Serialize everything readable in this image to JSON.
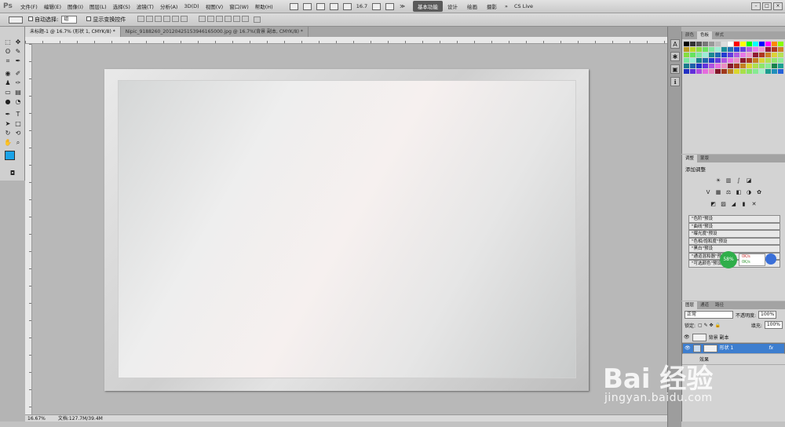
{
  "app": {
    "logo": "Ps"
  },
  "menu": {
    "items": [
      "文件(F)",
      "编辑(E)",
      "图像(I)",
      "图层(L)",
      "选择(S)",
      "滤镜(T)",
      "分析(A)",
      "3D(D)",
      "视图(V)",
      "窗口(W)",
      "帮助(H)"
    ],
    "zoom": "16.7",
    "overflow": "≫",
    "workspaces": [
      "基本功能",
      "设计",
      "绘画",
      "摄影"
    ],
    "cs_live": "CS Live"
  },
  "options": {
    "auto_select_label": "自动选择:",
    "auto_select_value": "组",
    "show_transform_label": "显示变换控件"
  },
  "tabs": [
    {
      "label": "未标题-1 @ 16.7% (形状 1, CMYK/8) *",
      "active": true
    },
    {
      "label": "Nipic_9188260_20120425153946165000.jpg @ 16.7%(背景 副本, CMYK/8) *",
      "active": false
    }
  ],
  "status": {
    "zoom": "16.67%",
    "doc": "文档:127.7M/39.4M"
  },
  "swatch_panel": {
    "tabs": [
      "颜色",
      "色板",
      "样式"
    ]
  },
  "adjust_panel": {
    "tabs": [
      "调整",
      "蒙版"
    ],
    "title": "添加调整",
    "presets": [
      "\"色阶\"预设",
      "\"曲线\"预设",
      "\"曝光度\"预设",
      "\"色相/饱和度\"预设",
      "\"黑白\"预设",
      "\"通道混和器\"预设",
      "\"可选颜色\"预设"
    ]
  },
  "layers_panel": {
    "tabs": [
      "图层",
      "通道",
      "路径"
    ],
    "blend": "正常",
    "opacity_label": "不透明度:",
    "opacity": "100%",
    "lock_label": "锁定:",
    "fill_label": "填充:",
    "fill": "100%",
    "layers": [
      {
        "name": "背景 副本",
        "selected": false
      },
      {
        "name": "形状 1",
        "selected": true
      },
      {
        "name": "效果",
        "selected": false
      }
    ],
    "fx": "fx"
  },
  "float_widget": {
    "percent": "58%",
    "up": "0K/s",
    "down": "0K/s"
  },
  "watermark": {
    "brand": "Bai 经验",
    "url": "jingyan.baidu.com"
  },
  "colors": {
    "accent": "#3d7ecf",
    "foreground": "#1aa3e8",
    "background": "#ffffff"
  }
}
